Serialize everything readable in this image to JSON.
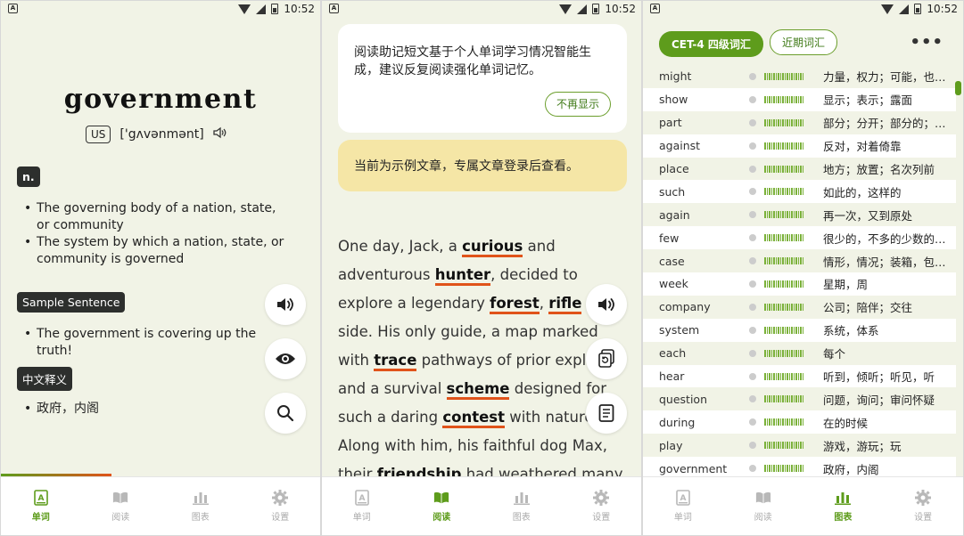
{
  "status": {
    "time": "10:52"
  },
  "nav": {
    "words": "单词",
    "read": "阅读",
    "chart": "图表",
    "settings": "设置"
  },
  "panel1": {
    "word": "government",
    "region": "US",
    "phonetic": "['gʌvənmənt]",
    "pos": "n.",
    "definitions": [
      "The governing body of a nation, state, or community",
      "The system by which a nation, state, or community is governed"
    ],
    "sample_label": "Sample Sentence",
    "sample": "The government is covering up the truth!",
    "chinese_label": "中文释义",
    "chinese": "政府，内阁"
  },
  "panel2": {
    "notice": "阅读助记短文基于个人单词学习情况智能生成，建议反复阅读强化单词记忆。",
    "nomore": "不再显示",
    "sample_notice": "当前为示例文章，专属文章登录后查看。",
    "article_parts": [
      {
        "t": "One day, Jack, a ",
        "h": false
      },
      {
        "t": "curious",
        "h": true
      },
      {
        "t": " and adventurous ",
        "h": false
      },
      {
        "t": "hunter",
        "h": true
      },
      {
        "t": ", decided to explore a legendary ",
        "h": false
      },
      {
        "t": "forest",
        "h": true
      },
      {
        "t": ", ",
        "h": false
      },
      {
        "t": "rifle",
        "h": true
      },
      {
        "t": " at his side. His only guide, a map marked with ",
        "h": false
      },
      {
        "t": "trace",
        "h": true
      },
      {
        "t": " pathways of prior explorers and a survival ",
        "h": false
      },
      {
        "t": "scheme",
        "h": true
      },
      {
        "t": " designed for such a daring ",
        "h": false
      },
      {
        "t": "contest",
        "h": true
      },
      {
        "t": " with nature. Along with him, his faithful dog Max, their ",
        "h": false
      },
      {
        "t": "friendship",
        "h": true
      },
      {
        "t": " had weathered many such expeditions.",
        "h": false
      }
    ]
  },
  "panel3": {
    "cet": "CET-4 四级词汇",
    "recent": "近期词汇",
    "more": "•••",
    "rows": [
      {
        "w": "might",
        "d": "力量，权力；可能，也…"
      },
      {
        "w": "show",
        "d": "显示；表示；露面"
      },
      {
        "w": "part",
        "d": "部分；分开；部分的；…"
      },
      {
        "w": "against",
        "d": "反对，对着倚靠"
      },
      {
        "w": "place",
        "d": "地方；放置；名次列前"
      },
      {
        "w": "such",
        "d": "如此的，这样的"
      },
      {
        "w": "again",
        "d": "再一次，又到原处"
      },
      {
        "w": "few",
        "d": "很少的，不多的少数的…"
      },
      {
        "w": "case",
        "d": "情形，情况；装箱，包…"
      },
      {
        "w": "week",
        "d": "星期，周"
      },
      {
        "w": "company",
        "d": "公司；陪伴；交往"
      },
      {
        "w": "system",
        "d": "系统，体系"
      },
      {
        "w": "each",
        "d": "每个"
      },
      {
        "w": "hear",
        "d": "听到，倾听；听见，听"
      },
      {
        "w": "question",
        "d": "问题，询问；审问怀疑"
      },
      {
        "w": "during",
        "d": "在的时候"
      },
      {
        "w": "play",
        "d": "游戏，游玩；玩"
      },
      {
        "w": "government",
        "d": "政府，内阁"
      }
    ]
  }
}
